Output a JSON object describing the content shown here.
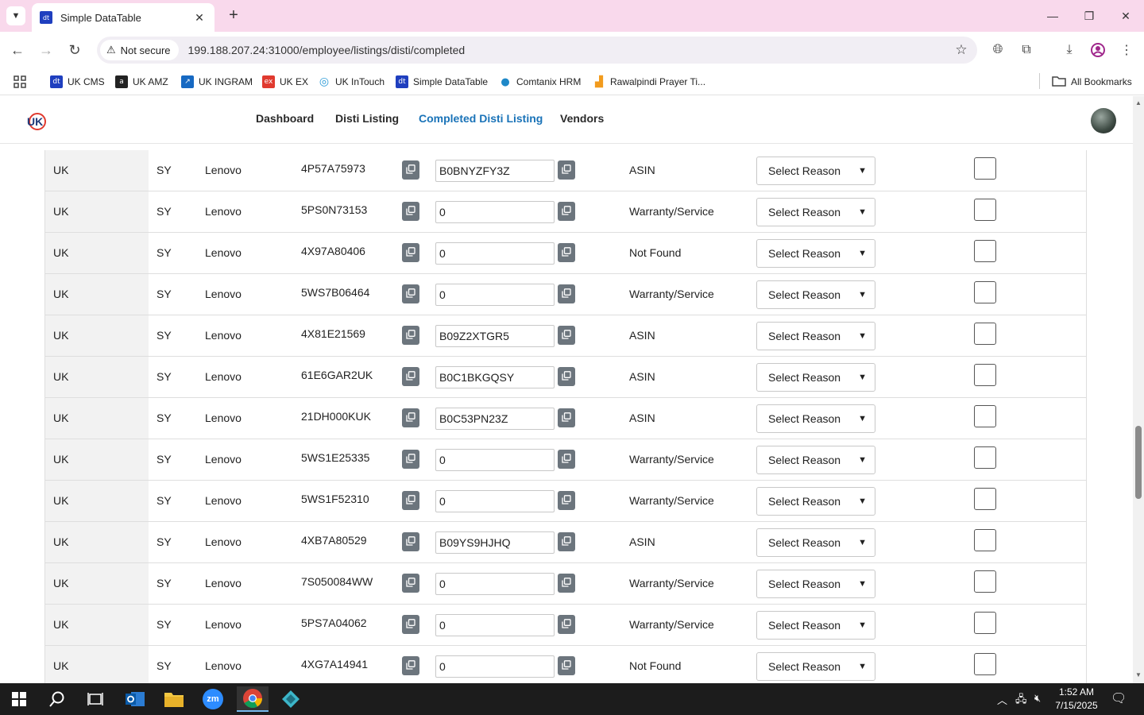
{
  "browser": {
    "tab_title": "Simple DataTable",
    "tab_favicon_text": "dt",
    "security_label": "Not secure",
    "url": "199.188.207.24:31000/employee/listings/disti/completed"
  },
  "bookmarks": [
    {
      "label": "UK CMS",
      "icon": "dt",
      "color": "#1f3fbf"
    },
    {
      "label": "UK AMZ",
      "icon": "a",
      "color": "#222222"
    },
    {
      "label": "UK INGRAM",
      "icon": "↗",
      "color": "#1769c2"
    },
    {
      "label": "UK EX",
      "icon": "ex",
      "color": "#e03a2f"
    },
    {
      "label": "UK InTouch",
      "icon": "◎",
      "color": "#2d9bd7"
    },
    {
      "label": "Simple DataTable",
      "icon": "dt",
      "color": "#1f3fbf"
    },
    {
      "label": "Comtanix HRM",
      "icon": "●",
      "color": "#1e88c8"
    },
    {
      "label": "Rawalpindi Prayer Ti...",
      "icon": "▟",
      "color": "#f29b1d"
    }
  ],
  "all_bookmarks_label": "All Bookmarks",
  "app_nav": {
    "dashboard": "Dashboard",
    "disti_listing": "Disti Listing",
    "completed_disti_listing": "Completed Disti Listing",
    "vendors": "Vendors"
  },
  "rows": [
    {
      "region": "UK",
      "code": "SY",
      "brand": "Lenovo",
      "part": "4P57A75973",
      "asin": "B0BNYZFY3Z",
      "status": "ASIN",
      "reason": "Select Reason"
    },
    {
      "region": "UK",
      "code": "SY",
      "brand": "Lenovo",
      "part": "5PS0N73153",
      "asin": "0",
      "status": "Warranty/Service",
      "reason": "Select Reason"
    },
    {
      "region": "UK",
      "code": "SY",
      "brand": "Lenovo",
      "part": "4X97A80406",
      "asin": "0",
      "status": "Not Found",
      "reason": "Select Reason"
    },
    {
      "region": "UK",
      "code": "SY",
      "brand": "Lenovo",
      "part": "5WS7B06464",
      "asin": "0",
      "status": "Warranty/Service",
      "reason": "Select Reason"
    },
    {
      "region": "UK",
      "code": "SY",
      "brand": "Lenovo",
      "part": "4X81E21569",
      "asin": "B09Z2XTGR5",
      "status": "ASIN",
      "reason": "Select Reason"
    },
    {
      "region": "UK",
      "code": "SY",
      "brand": "Lenovo",
      "part": "61E6GAR2UK",
      "asin": "B0C1BKGQSY",
      "status": "ASIN",
      "reason": "Select Reason"
    },
    {
      "region": "UK",
      "code": "SY",
      "brand": "Lenovo",
      "part": "21DH000KUK",
      "asin": "B0C53PN23Z",
      "status": "ASIN",
      "reason": "Select Reason"
    },
    {
      "region": "UK",
      "code": "SY",
      "brand": "Lenovo",
      "part": "5WS1E25335",
      "asin": "0",
      "status": "Warranty/Service",
      "reason": "Select Reason"
    },
    {
      "region": "UK",
      "code": "SY",
      "brand": "Lenovo",
      "part": "5WS1F52310",
      "asin": "0",
      "status": "Warranty/Service",
      "reason": "Select Reason"
    },
    {
      "region": "UK",
      "code": "SY",
      "brand": "Lenovo",
      "part": "4XB7A80529",
      "asin": "B09YS9HJHQ",
      "status": "ASIN",
      "reason": "Select Reason"
    },
    {
      "region": "UK",
      "code": "SY",
      "brand": "Lenovo",
      "part": "7S050084WW",
      "asin": "0",
      "status": "Warranty/Service",
      "reason": "Select Reason"
    },
    {
      "region": "UK",
      "code": "SY",
      "brand": "Lenovo",
      "part": "5PS7A04062",
      "asin": "0",
      "status": "Warranty/Service",
      "reason": "Select Reason"
    },
    {
      "region": "UK",
      "code": "SY",
      "brand": "Lenovo",
      "part": "4XG7A14941",
      "asin": "0",
      "status": "Not Found",
      "reason": "Select Reason"
    }
  ],
  "taskbar": {
    "time": "1:52 AM",
    "date": "7/15/2025",
    "zoom_label": "zm"
  },
  "colors": {
    "accent": "#1a73b8",
    "copy_button": "#6c757d",
    "titlebar": "#f9d9ec"
  }
}
